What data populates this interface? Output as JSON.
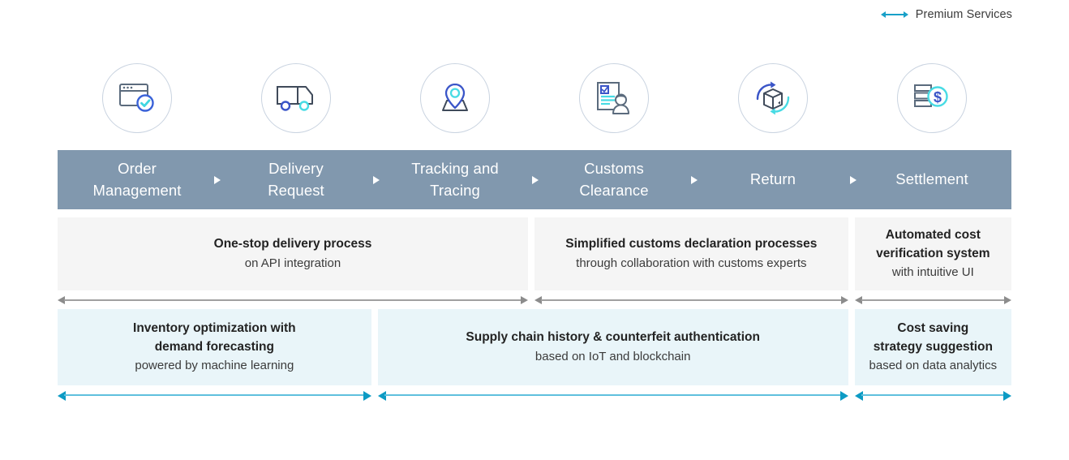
{
  "legend": {
    "icon": "double-arrow-icon",
    "label": "Premium Services",
    "color": "#18a0c8"
  },
  "process": {
    "bar_color": "#8198ae",
    "stages": [
      {
        "label": "Order\nManagement",
        "icon": "browser-window-check-icon"
      },
      {
        "label": "Delivery\nRequest",
        "icon": "delivery-truck-icon"
      },
      {
        "label": "Tracking and\nTracing",
        "icon": "map-location-pin-icon"
      },
      {
        "label": "Customs\nClearance",
        "icon": "document-officer-icon"
      },
      {
        "label": "Return",
        "icon": "return-box-arrows-icon"
      },
      {
        "label": "Settlement",
        "icon": "money-documents-dollar-icon"
      }
    ]
  },
  "services_row1": {
    "background": "#f5f5f5",
    "arrow_color": "#8c8c8c",
    "panels": [
      {
        "title": "One-stop delivery process",
        "subtitle": "on API integration",
        "span": 3
      },
      {
        "title": "Simplified customs declaration processes",
        "subtitle": "through collaboration with customs experts",
        "span": 2
      },
      {
        "title": "Automated cost\nverification system",
        "subtitle": "with intuitive UI",
        "span": 1
      }
    ]
  },
  "services_row2": {
    "background": "#e9f5f9",
    "arrow_color": "#0d9bc4",
    "panels": [
      {
        "title": "Inventory optimization with\ndemand forecasting",
        "subtitle": "powered by machine learning",
        "span": 2
      },
      {
        "title": "Supply chain history & counterfeit authentication",
        "subtitle": "based on IoT and blockchain",
        "span": 3
      },
      {
        "title": "Cost saving\nstrategy suggestion",
        "subtitle": "based on data analytics",
        "span": 1
      }
    ]
  }
}
